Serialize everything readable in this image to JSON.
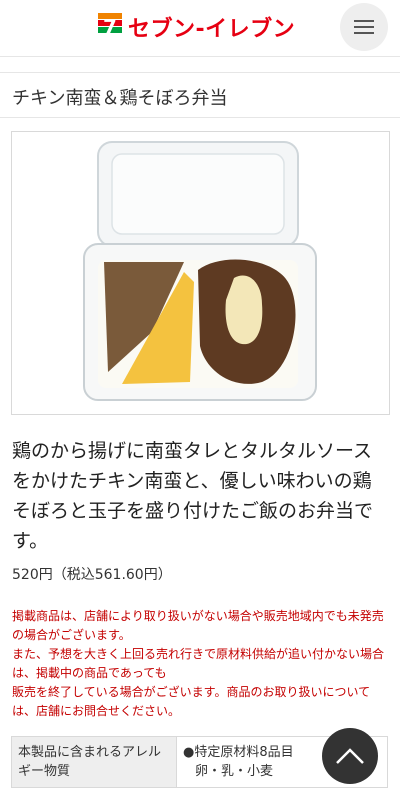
{
  "header": {
    "brand_numeral": "7",
    "brand_name": "セブン-イレブン",
    "menu_icon": "hamburger-menu-icon"
  },
  "product": {
    "title": "チキン南蛮＆鶏そぼろ弁当",
    "image_alt": "product-photo",
    "description": "鶏のから揚げに南蛮タレとタルタルソースをかけたチキン南蛮と、優しい味わいの鶏そぼろと玉子を盛り付けたご飯のお弁当です。",
    "price": "520円（税込561.60円）"
  },
  "notice": [
    "掲載商品は、店舗により取り扱いがない場合や販売地域内でも未発売の場合がございます。",
    "また、予想を大きく上回る売れ行きで原材料供給が追い付かない場合は、掲載中の商品であっても",
    "販売を終了している場合がございます。商品のお取り扱いについては、店舗にお問合せください。"
  ],
  "allergy": {
    "label": "本製品に含まれるアレルギー物質",
    "value_line1": "●特定原材料8品目",
    "value_line2": "卵・乳・小麦"
  },
  "colors": {
    "brand_red": "#e60012",
    "brand_orange": "#f08300",
    "brand_green": "#00a040",
    "notice_red": "#c40000"
  },
  "scroll_top_icon": "chevron-up-icon"
}
